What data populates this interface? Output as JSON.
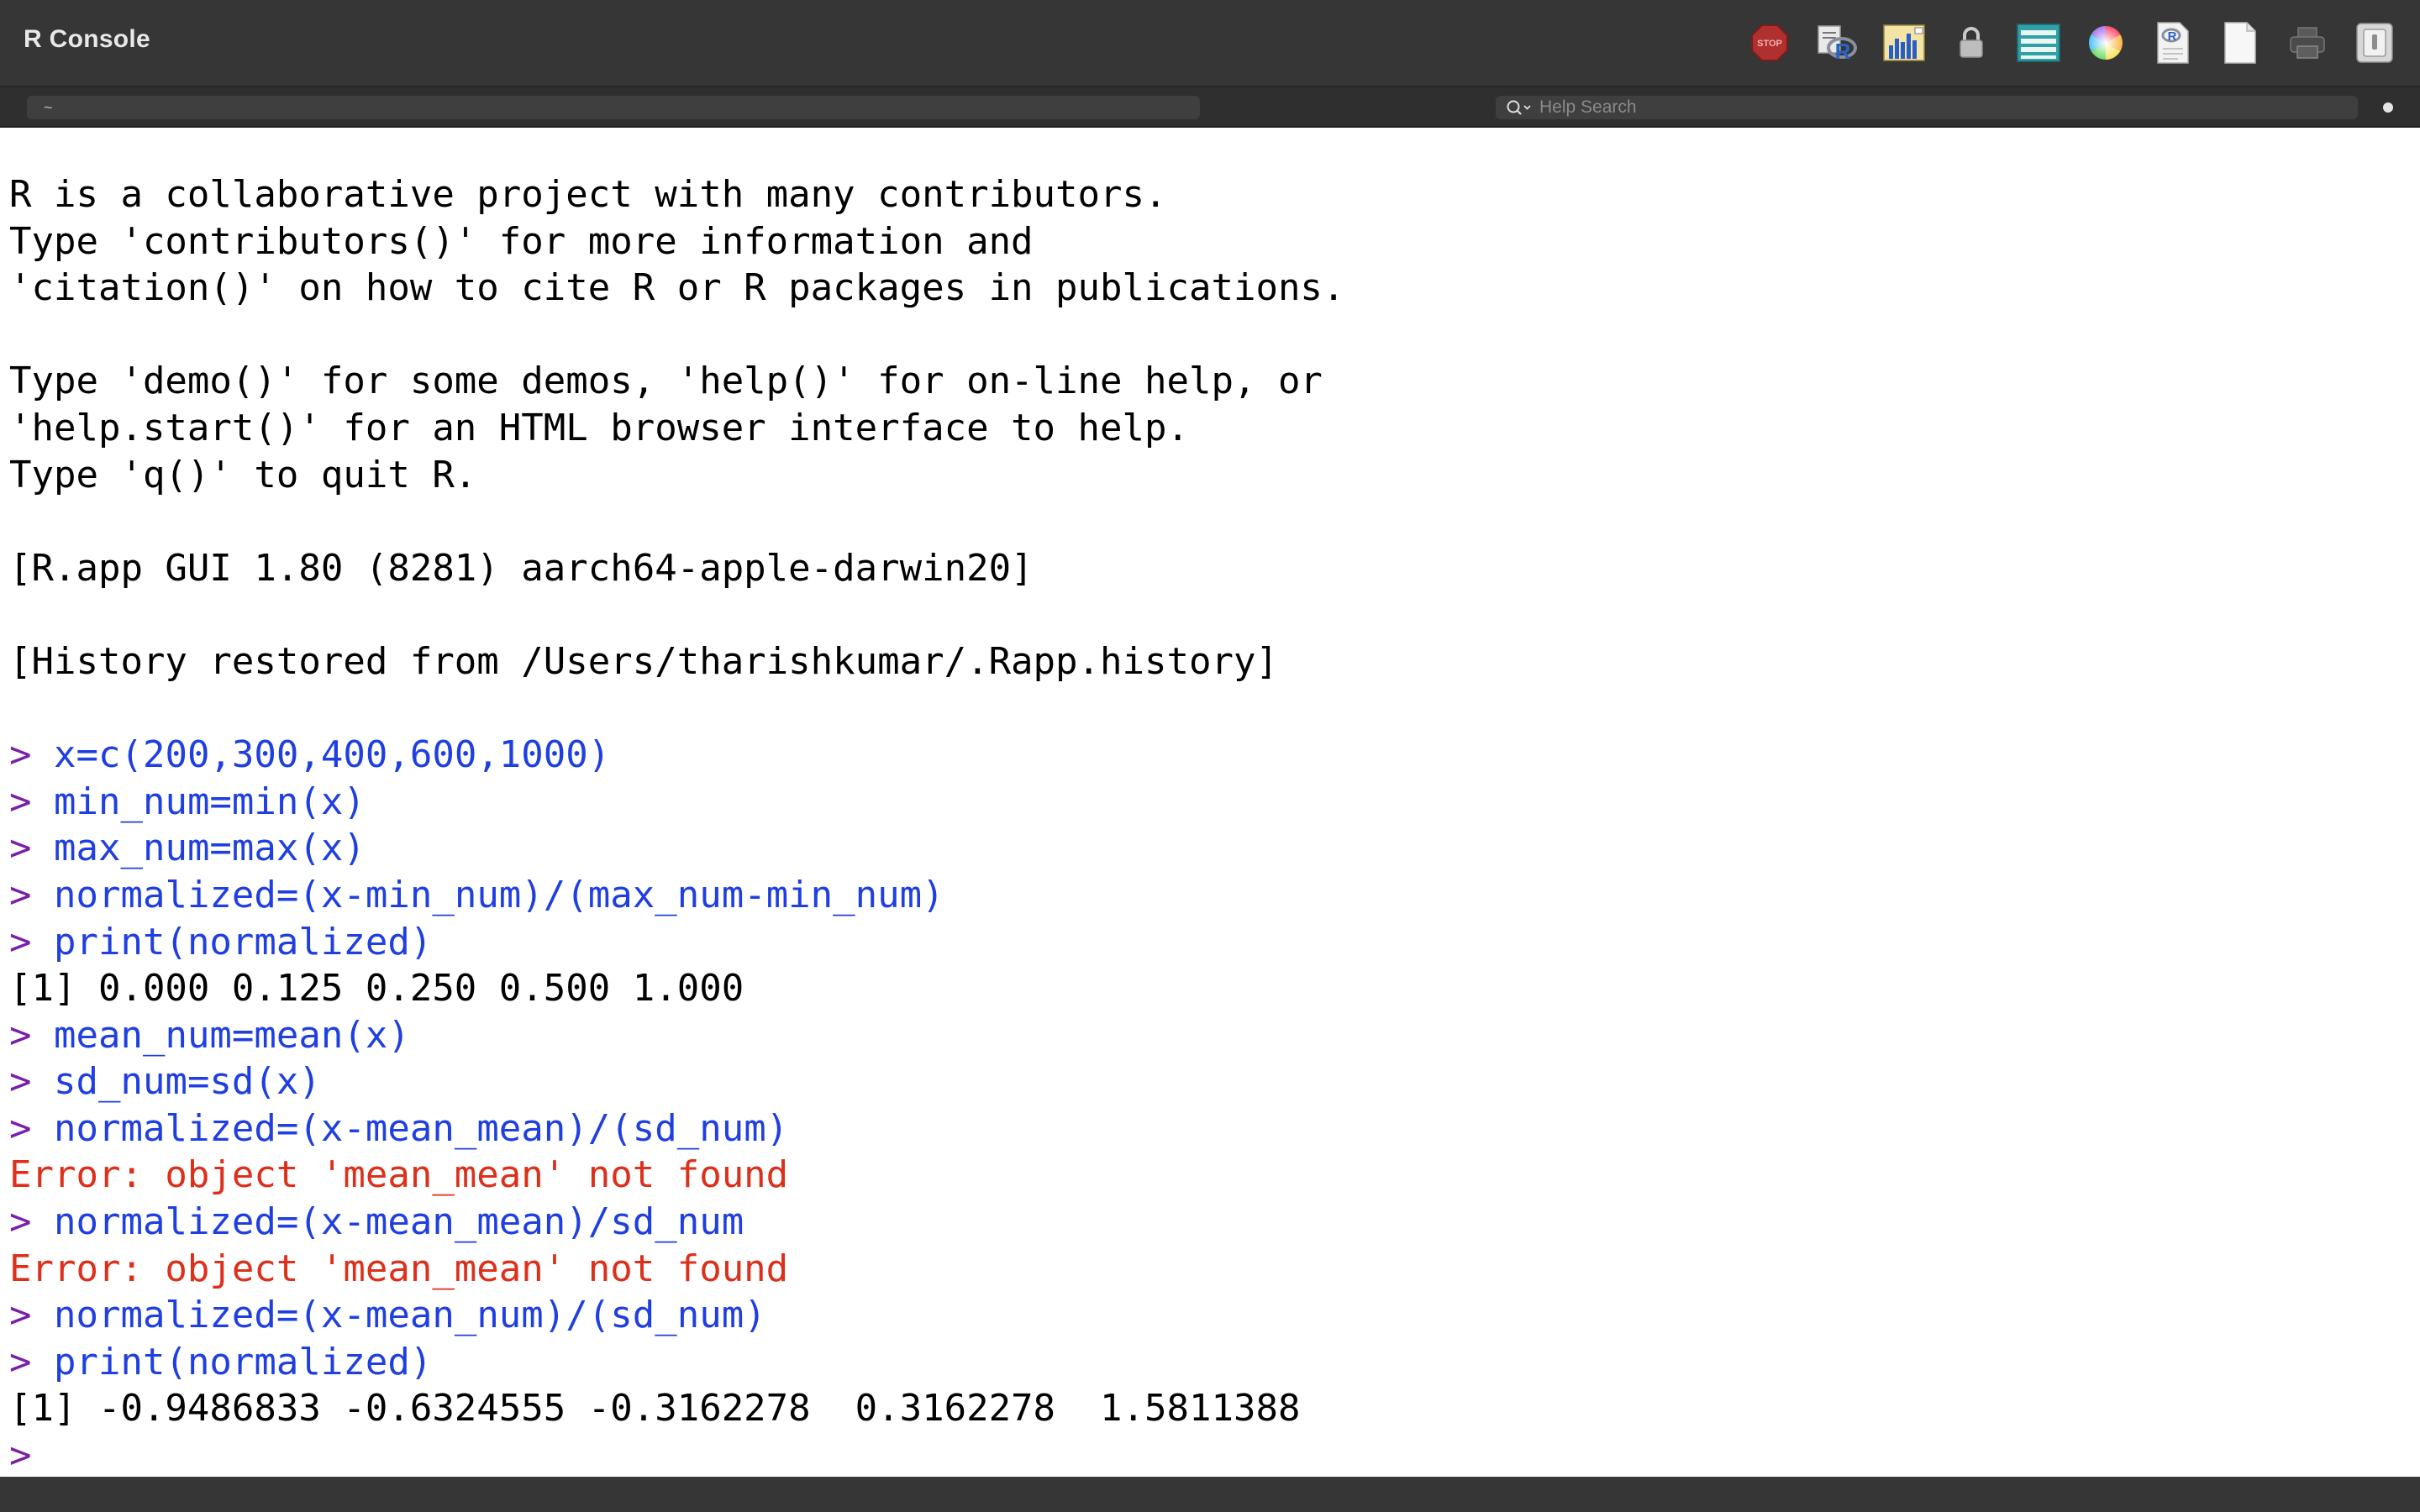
{
  "window": {
    "title": "R Console"
  },
  "toolbar": {
    "tools": [
      {
        "name": "stop-icon",
        "label": "STOP"
      },
      {
        "name": "source-r-script-icon"
      },
      {
        "name": "quartz-graphics-icon"
      },
      {
        "name": "lock-icon"
      },
      {
        "name": "workspace-browser-icon"
      },
      {
        "name": "color-wheel-icon"
      },
      {
        "name": "open-document-icon"
      },
      {
        "name": "new-document-icon"
      },
      {
        "name": "print-icon"
      },
      {
        "name": "drawer-toggle-icon"
      }
    ]
  },
  "path_field": {
    "value": "~"
  },
  "search": {
    "placeholder": "Help Search"
  },
  "colors": {
    "output": "#000000",
    "command": "#1f3fe0",
    "error": "#dd2f1a",
    "prompt": "#7a1fa8",
    "titlebar": "#363636"
  },
  "console": {
    "lines": [
      {
        "type": "output",
        "text": "R is a collaborative project with many contributors."
      },
      {
        "type": "output",
        "text": "Type 'contributors()' for more information and"
      },
      {
        "type": "output",
        "text": "'citation()' on how to cite R or R packages in publications."
      },
      {
        "type": "blank",
        "text": ""
      },
      {
        "type": "output",
        "text": "Type 'demo()' for some demos, 'help()' for on-line help, or"
      },
      {
        "type": "output",
        "text": "'help.start()' for an HTML browser interface to help."
      },
      {
        "type": "output",
        "text": "Type 'q()' to quit R."
      },
      {
        "type": "blank",
        "text": ""
      },
      {
        "type": "output",
        "text": "[R.app GUI 1.80 (8281) aarch64-apple-darwin20]"
      },
      {
        "type": "blank",
        "text": ""
      },
      {
        "type": "output",
        "text": "[History restored from /Users/tharishkumar/.Rapp.history]"
      },
      {
        "type": "blank",
        "text": ""
      },
      {
        "type": "command",
        "prompt": ">",
        "text": "x=c(200,300,400,600,1000)"
      },
      {
        "type": "command",
        "prompt": ">",
        "text": "min_num=min(x)"
      },
      {
        "type": "command",
        "prompt": ">",
        "text": "max_num=max(x)"
      },
      {
        "type": "command",
        "prompt": ">",
        "text": "normalized=(x-min_num)/(max_num-min_num)"
      },
      {
        "type": "command",
        "prompt": ">",
        "text": "print(normalized)"
      },
      {
        "type": "output",
        "text": "[1] 0.000 0.125 0.250 0.500 1.000"
      },
      {
        "type": "command",
        "prompt": ">",
        "text": "mean_num=mean(x)"
      },
      {
        "type": "command",
        "prompt": ">",
        "text": "sd_num=sd(x)"
      },
      {
        "type": "command",
        "prompt": ">",
        "text": "normalized=(x-mean_mean)/(sd_num)"
      },
      {
        "type": "error",
        "text": "Error: object 'mean_mean' not found"
      },
      {
        "type": "command",
        "prompt": ">",
        "text": "normalized=(x-mean_mean)/sd_num"
      },
      {
        "type": "error",
        "text": "Error: object 'mean_mean' not found"
      },
      {
        "type": "command",
        "prompt": ">",
        "text": "normalized=(x-mean_num)/(sd_num)"
      },
      {
        "type": "command",
        "prompt": ">",
        "text": "print(normalized)"
      },
      {
        "type": "output",
        "text": "[1] -0.9486833 -0.6324555 -0.3162278  0.3162278  1.5811388"
      },
      {
        "type": "input",
        "prompt": ">",
        "text": ""
      }
    ]
  }
}
